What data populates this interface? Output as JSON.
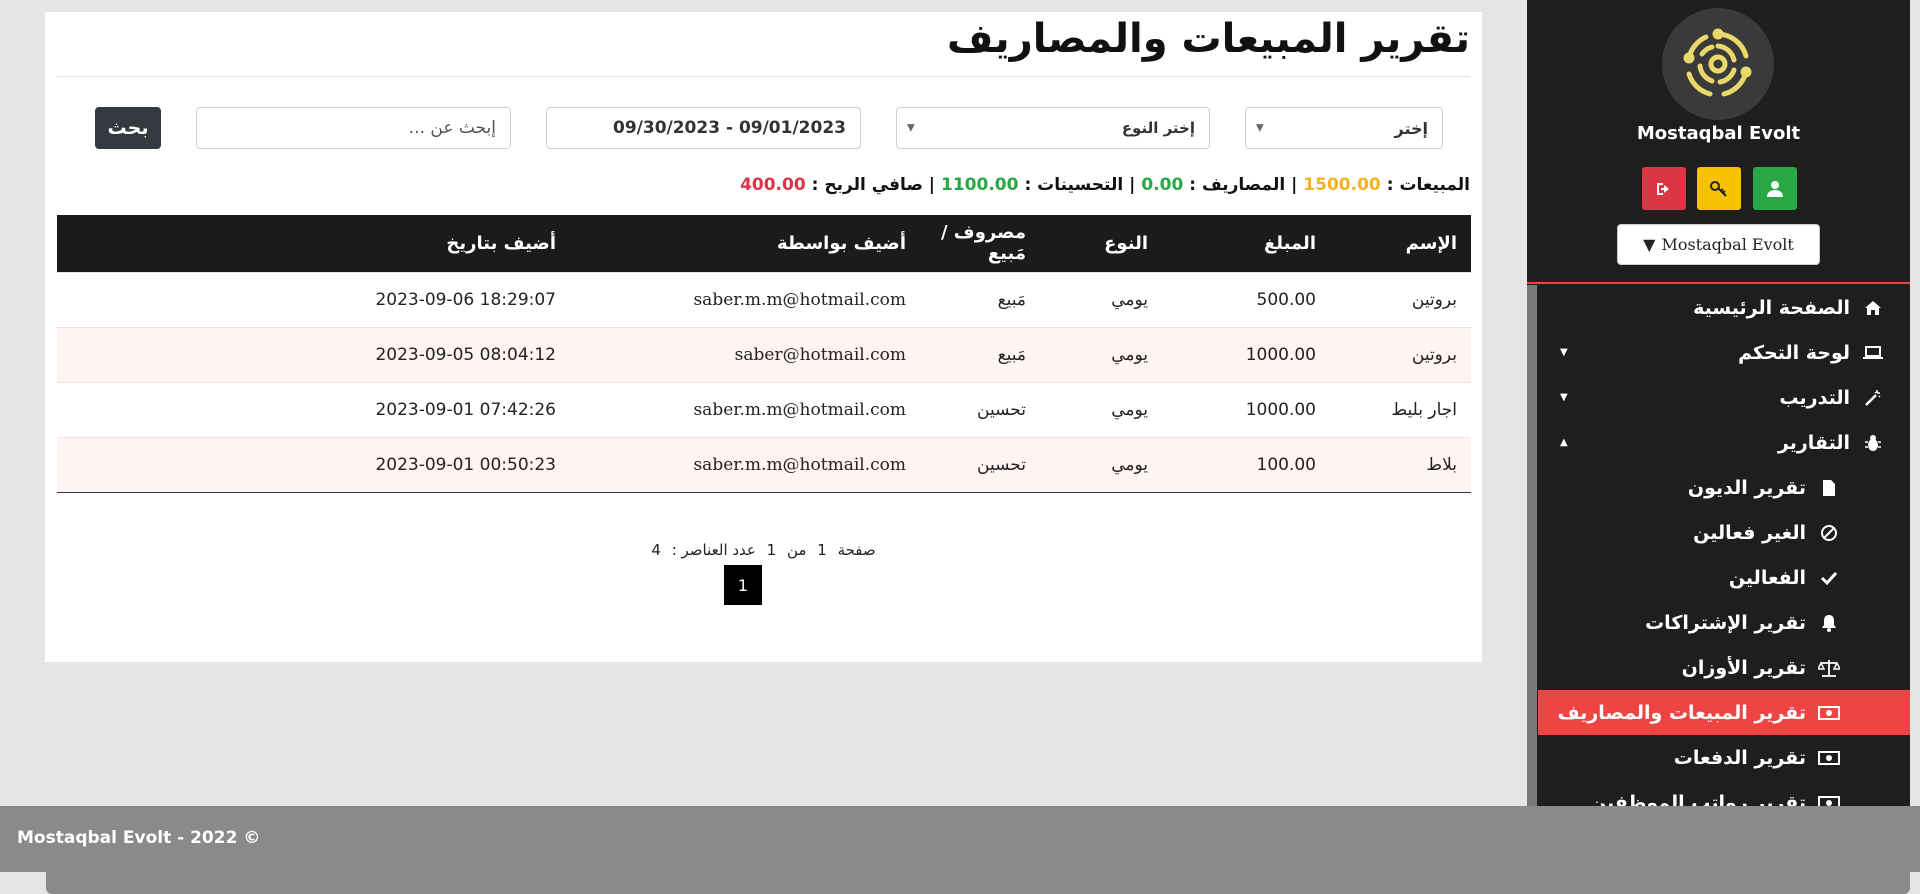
{
  "page": {
    "title": "تقرير المبيعات والمصاريف"
  },
  "filters": {
    "select_one": "إختر",
    "select_type": "إختر النوع",
    "date_range": "09/30/2023 - 09/01/2023",
    "search_placeholder": "إبحث عن ...",
    "search_button": "بحث"
  },
  "summary": {
    "sales_label": "المبيعات :",
    "sales_value": "1500.00",
    "expenses_label": "| المصاريف :",
    "expenses_value": "0.00",
    "improvements_label": "| التحسينات :",
    "improvements_value": "1100.00",
    "profit_label": "| صافي الربح :",
    "profit_value": "400.00"
  },
  "table": {
    "headers": [
      "الإسم",
      "المبلغ",
      "النوع",
      "مصروف / مَبيع",
      "أضيف بواسطة",
      "أضيف بتاريخ"
    ],
    "rows": [
      [
        "بروتين",
        "500.00",
        "يومي",
        "مَبيع",
        "saber.m.m@hotmail.com",
        "2023-09-06 18:29:07"
      ],
      [
        "بروتين",
        "1000.00",
        "يومي",
        "مَبيع",
        "saber@hotmail.com",
        "2023-09-05 08:04:12"
      ],
      [
        "اجار بليط",
        "1000.00",
        "يومي",
        "تحسين",
        "saber.m.m@hotmail.com",
        "2023-09-01 07:42:26"
      ],
      [
        "بلاط",
        "100.00",
        "يومي",
        "تحسين",
        "saber.m.m@hotmail.com",
        "2023-09-01 00:50:23"
      ]
    ]
  },
  "pagination": {
    "page_word": "صفحة",
    "current": "1",
    "of_word": "من",
    "total": "1",
    "count_label": "عدد العناصر :",
    "count": "4",
    "active_page": "1"
  },
  "sidebar": {
    "brand": "Mostaqbal Evolt",
    "user_menu": "Mostaqbal Evolt",
    "items": [
      {
        "label": "الصفحة الرئيسية",
        "icon": "home-icon"
      },
      {
        "label": "لوحة التحكم",
        "icon": "laptop-icon"
      },
      {
        "label": "التدريب",
        "icon": "magic-wand-icon"
      },
      {
        "label": "التقارير",
        "icon": "bug-icon"
      },
      {
        "label": "تقرير الديون",
        "icon": "file-icon"
      },
      {
        "label": "الغير فعالين",
        "icon": "ban-icon"
      },
      {
        "label": "الفعالين",
        "icon": "check-icon"
      },
      {
        "label": "تقرير الإشتراكات",
        "icon": "bell-icon"
      },
      {
        "label": "تقرير الأوزان",
        "icon": "scale-icon"
      },
      {
        "label": "تقرير المبيعات والمصاريف",
        "icon": "money-icon"
      },
      {
        "label": "تقرير الدفعات",
        "icon": "money-icon"
      },
      {
        "label": "تقرير رواتب الموظفين",
        "icon": "money-icon"
      }
    ]
  },
  "footer": {
    "text": "Mostaqbal Evolt - 2022 ©"
  },
  "colors": {
    "accent_red": "#ef4444",
    "sales_yellow": "#f4b223",
    "positive_green": "#28a745",
    "profit_red": "#dc3545",
    "sidebar_bg": "#1e1e1e"
  }
}
